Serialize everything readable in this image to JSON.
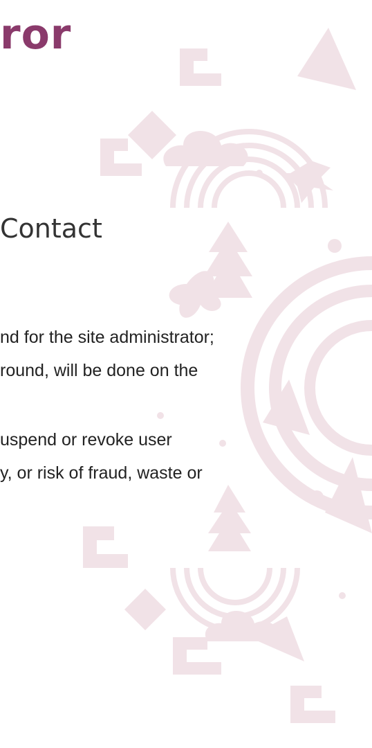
{
  "header": {
    "title_fragment": "ror"
  },
  "section": {
    "contact_heading": "Contact"
  },
  "body": {
    "line1": "nd for the site administrator;",
    "line2": "round, will be done on the",
    "line3": "uspend or revoke user",
    "line4": "y, or risk of fraud, waste or"
  },
  "colors": {
    "title": "#8a3a6b",
    "text": "#222222",
    "heading": "#333333",
    "pattern": "#f1e2e7"
  },
  "icons": {
    "background": "decorative-folk-pattern",
    "bird": "hummingbird-icon",
    "tree": "pine-tree-icon",
    "flower": "flower-icon",
    "rainbow": "rainbow-icon",
    "diamond": "diamond-motif-icon",
    "sun": "concentric-sun-icon"
  }
}
